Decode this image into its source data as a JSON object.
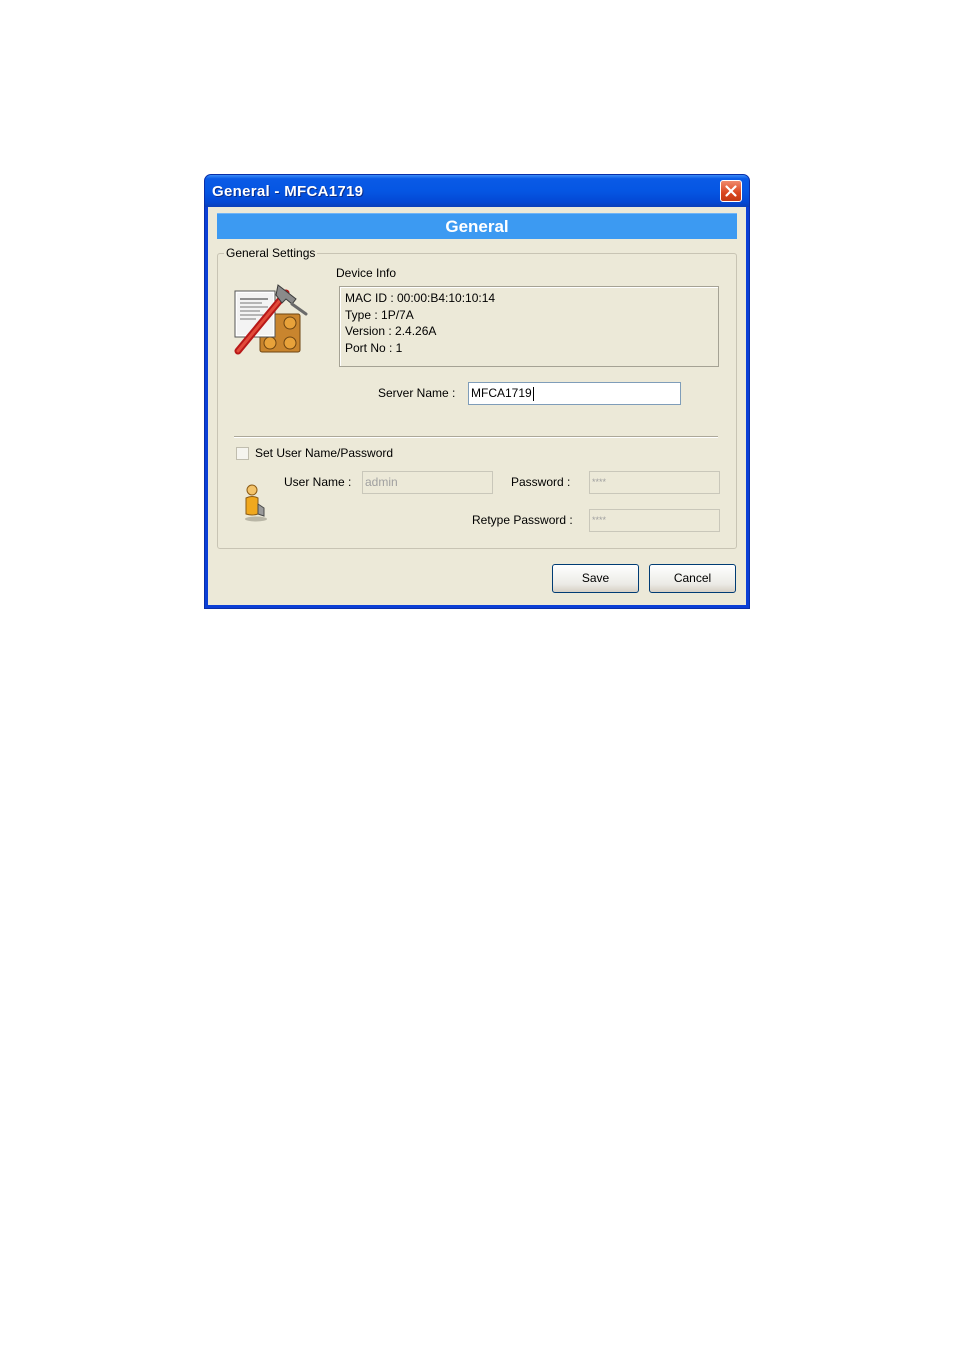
{
  "window": {
    "title": "General - MFCA1719",
    "banner": "General"
  },
  "general_settings": {
    "legend": "General Settings",
    "device_info_label": "Device Info",
    "device_info_lines": [
      "MAC ID : 00:00:B4:10:10:14",
      "Type : 1P/7A",
      "Version : 2.4.26A",
      "Port No : 1"
    ],
    "server_name_label": "Server Name :",
    "server_name_value": "MFCA1719"
  },
  "credentials": {
    "checkbox_label": "Set User Name/Password",
    "checked": false,
    "user_name_label": "User Name :",
    "user_name_value": "admin",
    "password_label": "Password :",
    "password_value": "****",
    "retype_password_label": "Retype Password :",
    "retype_password_value": "****"
  },
  "buttons": {
    "save": "Save",
    "cancel": "Cancel"
  },
  "icons": {
    "close": "close-icon",
    "settings": "document-hammer-icon",
    "user": "user-icon"
  }
}
